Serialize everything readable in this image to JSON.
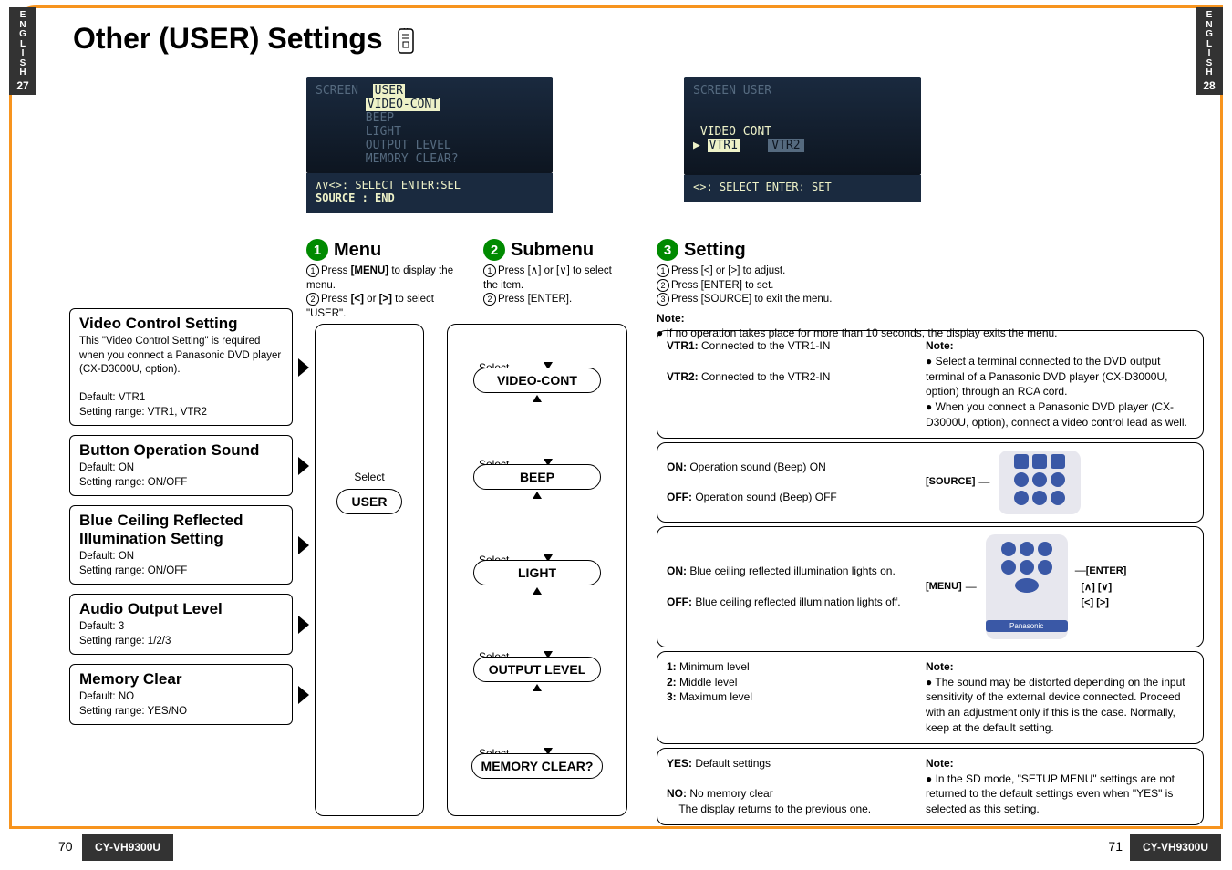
{
  "title": "Other (USER) Settings",
  "side": {
    "lang": "E\nN\nG\nL\nI\nS\nH",
    "left_num": "27",
    "right_num": "28"
  },
  "footer": {
    "model": "CY-VH9300U",
    "page_left": "70",
    "page_right": "71"
  },
  "screen_left": {
    "header": "SCREEN",
    "user": "USER",
    "items": [
      "VIDEO-CONT",
      "BEEP",
      "LIGHT",
      "OUTPUT LEVEL",
      "MEMORY CLEAR?"
    ],
    "hint": "∧∨<>: SELECT   ENTER:SEL",
    "hint2": "SOURCE : END"
  },
  "menu": {
    "num": "1",
    "title": "Menu",
    "line1a": "Press ",
    "line1b": "[MENU]",
    "line1c": " to display the menu.",
    "line2a": "Press ",
    "line2b": "[<] ",
    "line2c": "or ",
    "line2d": "[>]",
    "line2e": " to select \"USER\"."
  },
  "submenu": {
    "num": "2",
    "title": "Submenu",
    "line1": "Press [∧] or [∨] to select the item.",
    "line2": "Press [ENTER]."
  },
  "screen_right": {
    "header": "SCREEN  USER",
    "row_label": "VIDEO CONT",
    "opt1": "VTR1",
    "opt2": "VTR2",
    "hint": "<>: SELECT   ENTER: SET"
  },
  "setting": {
    "num": "3",
    "title": "Setting",
    "line1": "Press [<] or [>] to adjust.",
    "line2": "Press [ENTER] to set.",
    "line3": "Press [SOURCE] to exit the menu.",
    "note_label": "Note:",
    "note": "If no operation takes place for more than 10 seconds, the display exits the menu."
  },
  "sections": [
    {
      "title": "Video Control Setting",
      "body": "This \"Video Control Setting\" is required when you connect a Panasonic DVD player (CX-D3000U, option).",
      "def": "Default: VTR1",
      "range": "Setting range: VTR1, VTR2"
    },
    {
      "title": "Button Operation Sound",
      "def": "Default: ON",
      "range": "Setting range: ON/OFF"
    },
    {
      "title": "Blue Ceiling Reflected Illumination Setting",
      "def": "Default: ON",
      "range": "Setting range: ON/OFF"
    },
    {
      "title": "Audio Output Level",
      "def": "Default: 3",
      "range": "Setting range: 1/2/3"
    },
    {
      "title": "Memory Clear",
      "def": "Default: NO",
      "range": "Setting range: YES/NO"
    }
  ],
  "user_pill": "USER",
  "select_label": "Select",
  "sub_pills": [
    "VIDEO-CONT",
    "BEEP",
    "LIGHT",
    "OUTPUT LEVEL",
    "MEMORY CLEAR?"
  ],
  "rboxes": [
    {
      "a1": "VTR1:",
      "a1t": " Connected to the VTR1-IN",
      "a2": "VTR2:",
      "a2t": " Connected to the VTR2-IN",
      "bnote": "Note:",
      "b1": "Select a terminal connected to the DVD output terminal of a Panasonic DVD player (CX-D3000U, option) through an RCA cord.",
      "b2": "When you connect a Panasonic DVD player (CX-D3000U, option), connect a video control lead as well."
    },
    {
      "a1": "ON:",
      "a1t": " Operation sound (Beep) ON",
      "a2": "OFF:",
      "a2t": " Operation sound (Beep) OFF",
      "key_source": "[SOURCE]"
    },
    {
      "a1": "ON:",
      "a1t": " Blue ceiling reflected illumination lights on.",
      "a2": "OFF:",
      "a2t": " Blue ceiling reflected illumination lights off.",
      "key_menu": "[MENU]",
      "key_enter": "[ENTER]",
      "key_ud": "[∧] [∨]",
      "key_lr": "[<] [>]"
    },
    {
      "a1": "1:",
      "a1t": " Minimum level",
      "a2": "2:",
      "a2t": " Middle level",
      "a3": "3:",
      "a3t": " Maximum level",
      "bnote": "Note:",
      "b1": "The sound may be distorted depending on the input sensitivity of the external device connected. Proceed with an adjustment only if this is the case. Normally, keep at the default setting."
    },
    {
      "a1": "YES:",
      "a1t": " Default settings",
      "a2": "NO:",
      "a2t": " No memory clear",
      "a2s": "The display returns to the previous one.",
      "bnote": "Note:",
      "b1": "In the SD mode, \"SETUP MENU\" settings are not returned to the default settings even when \"YES\" is selected as this setting."
    }
  ],
  "remote": {
    "brand": "Panasonic"
  }
}
